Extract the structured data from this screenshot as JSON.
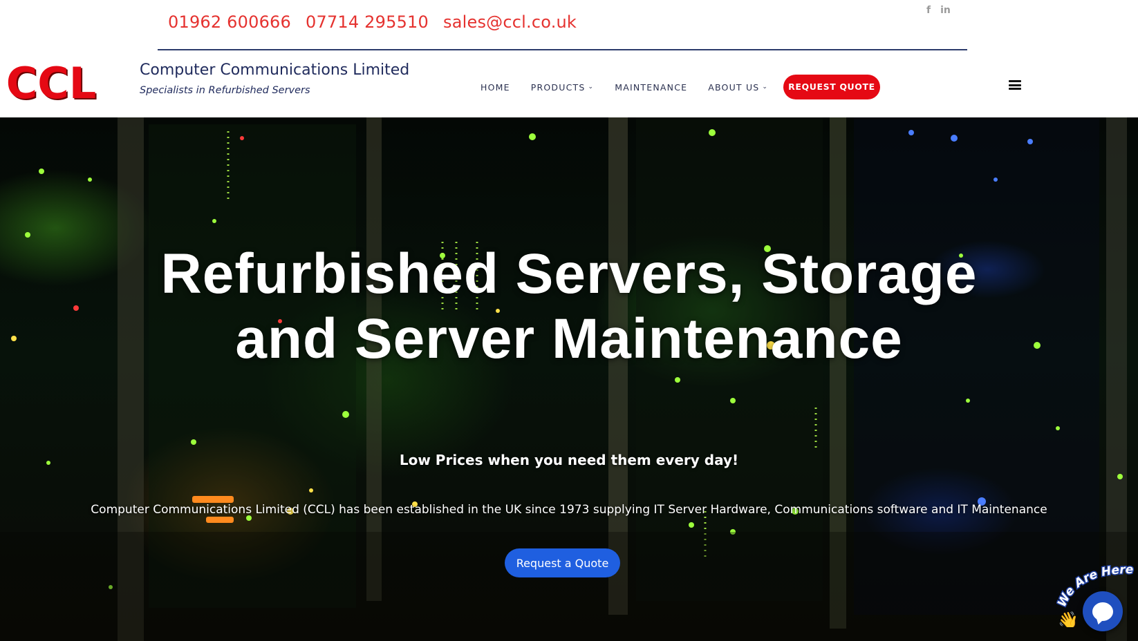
{
  "topbar": {
    "phone1": "01962 600666",
    "phone2": "07714 295510",
    "email": "sales@ccl.co.uk",
    "social": [
      {
        "icon": "facebook-icon",
        "glyph": "f"
      },
      {
        "icon": "linkedin-icon",
        "glyph": "in"
      }
    ]
  },
  "header": {
    "logo_text": "CCL",
    "company_name": "Computer Communications Limited",
    "tagline": "Specialists in Refurbished Servers",
    "nav": {
      "home": "HOME",
      "products": "PRODUCTS",
      "maintenance": "MAINTENANCE",
      "about": "ABOUT US",
      "quote": "REQUEST QUOTE"
    },
    "menu_icon": "hamburger-icon"
  },
  "hero": {
    "title_line1": "Refurbished Servers, Storage",
    "title_line2": "and Server Maintenance",
    "subtitle": "Low Prices when you need them every day!",
    "description": "Computer Communications Limited (CCL) has been established in the UK since 1973 supplying IT Server Hardware, Communications software and IT Maintenance",
    "button": "Request a Quote"
  },
  "chat": {
    "label": "We Are Here!",
    "icon": "chat-icon"
  },
  "colors": {
    "accent_red": "#e50914",
    "contact_red": "#e5322f",
    "navy": "#1f2a5c",
    "button_blue": "#1f5fe0"
  }
}
